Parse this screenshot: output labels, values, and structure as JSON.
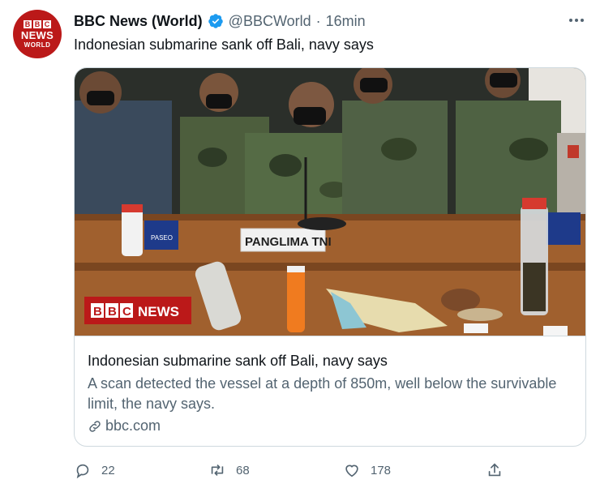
{
  "account": {
    "avatar_top": "BBC",
    "avatar_mid": "NEWS",
    "avatar_bottom": "WORLD",
    "name": "BBC News (World)",
    "handle": "@BBCWorld",
    "separator": "·",
    "time": "16min",
    "verified": true
  },
  "tweet": {
    "text": "Indonesian submarine sank off Bali, navy says"
  },
  "card": {
    "image_watermark_blocks": [
      "B",
      "B",
      "C"
    ],
    "image_watermark_word": "NEWS",
    "placard_text": "PANGLIMA TNI",
    "box_label": "PASEO",
    "title": "Indonesian submarine sank off Bali, navy says",
    "description": "A scan detected the vessel at a depth of 850m, well below the survivable limit, the navy says.",
    "domain": "bbc.com"
  },
  "actions": {
    "reply_count": "22",
    "retweet_count": "68",
    "like_count": "178"
  },
  "colors": {
    "brand_red": "#bb1919",
    "verified_blue": "#1d9bf0",
    "secondary_text": "#536471"
  }
}
